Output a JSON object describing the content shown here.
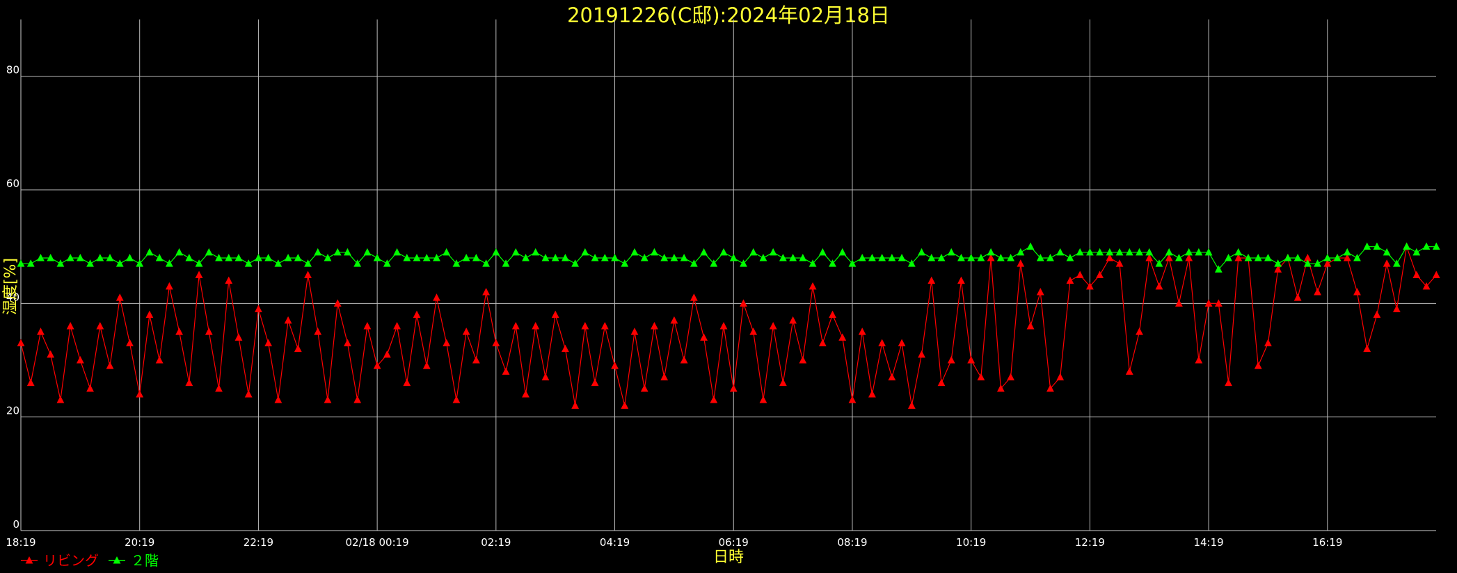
{
  "chart_data": {
    "type": "line",
    "title": "20191226(C邸):2024年02月18日",
    "xlabel": "日時",
    "ylabel": "湿度[%]",
    "ylim": [
      0,
      90
    ],
    "yticks": [
      0,
      20,
      40,
      60,
      80
    ],
    "x_ticks": [
      "18:19",
      "20:19",
      "22:19",
      "02/18 00:19",
      "02:19",
      "04:19",
      "06:19",
      "08:19",
      "10:19",
      "12:19",
      "14:19",
      "16:19"
    ],
    "x_start_hours": 0,
    "x_end_hours": 23.83,
    "point_interval_minutes": 10,
    "grid": true,
    "legend_position": "bottom-left",
    "colors": {
      "background": "#000000",
      "title": "#ffff33",
      "axis_text": "#ffffff",
      "grid": "#ffffff",
      "series_red": "#ff0000",
      "series_green": "#00ff00"
    },
    "series": [
      {
        "name": "リビング",
        "color": "#ff0000",
        "values": [
          33,
          26,
          35,
          31,
          23,
          36,
          30,
          25,
          36,
          29,
          41,
          33,
          24,
          38,
          30,
          43,
          35,
          26,
          45,
          35,
          25,
          44,
          34,
          24,
          39,
          33,
          23,
          37,
          32,
          45,
          35,
          23,
          40,
          33,
          23,
          36,
          29,
          31,
          36,
          26,
          38,
          29,
          41,
          33,
          23,
          35,
          30,
          42,
          33,
          28,
          36,
          24,
          36,
          27,
          38,
          32,
          22,
          36,
          26,
          36,
          29,
          22,
          35,
          25,
          36,
          27,
          37,
          30,
          41,
          34,
          23,
          36,
          25,
          40,
          35,
          23,
          36,
          26,
          37,
          30,
          43,
          33,
          38,
          34,
          23,
          35,
          24,
          33,
          27,
          33,
          22,
          31,
          44,
          26,
          30,
          44,
          30,
          27,
          48,
          25,
          27,
          47,
          36,
          42,
          25,
          27,
          44,
          45,
          43,
          45,
          48,
          47,
          28,
          35,
          48,
          43,
          48,
          40,
          48,
          30,
          40,
          40,
          26,
          48,
          48,
          29,
          33,
          46,
          48,
          41,
          48,
          42,
          47,
          48,
          48,
          42,
          32,
          38,
          47,
          39,
          50,
          45,
          43,
          45
        ]
      },
      {
        "name": "２階",
        "color": "#00ff00",
        "values": [
          47,
          47,
          48,
          48,
          47,
          48,
          48,
          47,
          48,
          48,
          47,
          48,
          47,
          49,
          48,
          47,
          49,
          48,
          47,
          49,
          48,
          48,
          48,
          47,
          48,
          48,
          47,
          48,
          48,
          47,
          49,
          48,
          49,
          49,
          47,
          49,
          48,
          47,
          49,
          48,
          48,
          48,
          48,
          49,
          47,
          48,
          48,
          47,
          49,
          47,
          49,
          48,
          49,
          48,
          48,
          48,
          47,
          49,
          48,
          48,
          48,
          47,
          49,
          48,
          49,
          48,
          48,
          48,
          47,
          49,
          47,
          49,
          48,
          47,
          49,
          48,
          49,
          48,
          48,
          48,
          47,
          49,
          47,
          49,
          47,
          48,
          48,
          48,
          48,
          48,
          47,
          49,
          48,
          48,
          49,
          48,
          48,
          48,
          49,
          48,
          48,
          49,
          50,
          48,
          48,
          49,
          48,
          49,
          49,
          49,
          49,
          49,
          49,
          49,
          49,
          47,
          49,
          48,
          49,
          49,
          49,
          46,
          48,
          49,
          48,
          48,
          48,
          47,
          48,
          48,
          47,
          47,
          48,
          48,
          49,
          48,
          50,
          50,
          49,
          47,
          50,
          49,
          50,
          50
        ]
      }
    ]
  }
}
